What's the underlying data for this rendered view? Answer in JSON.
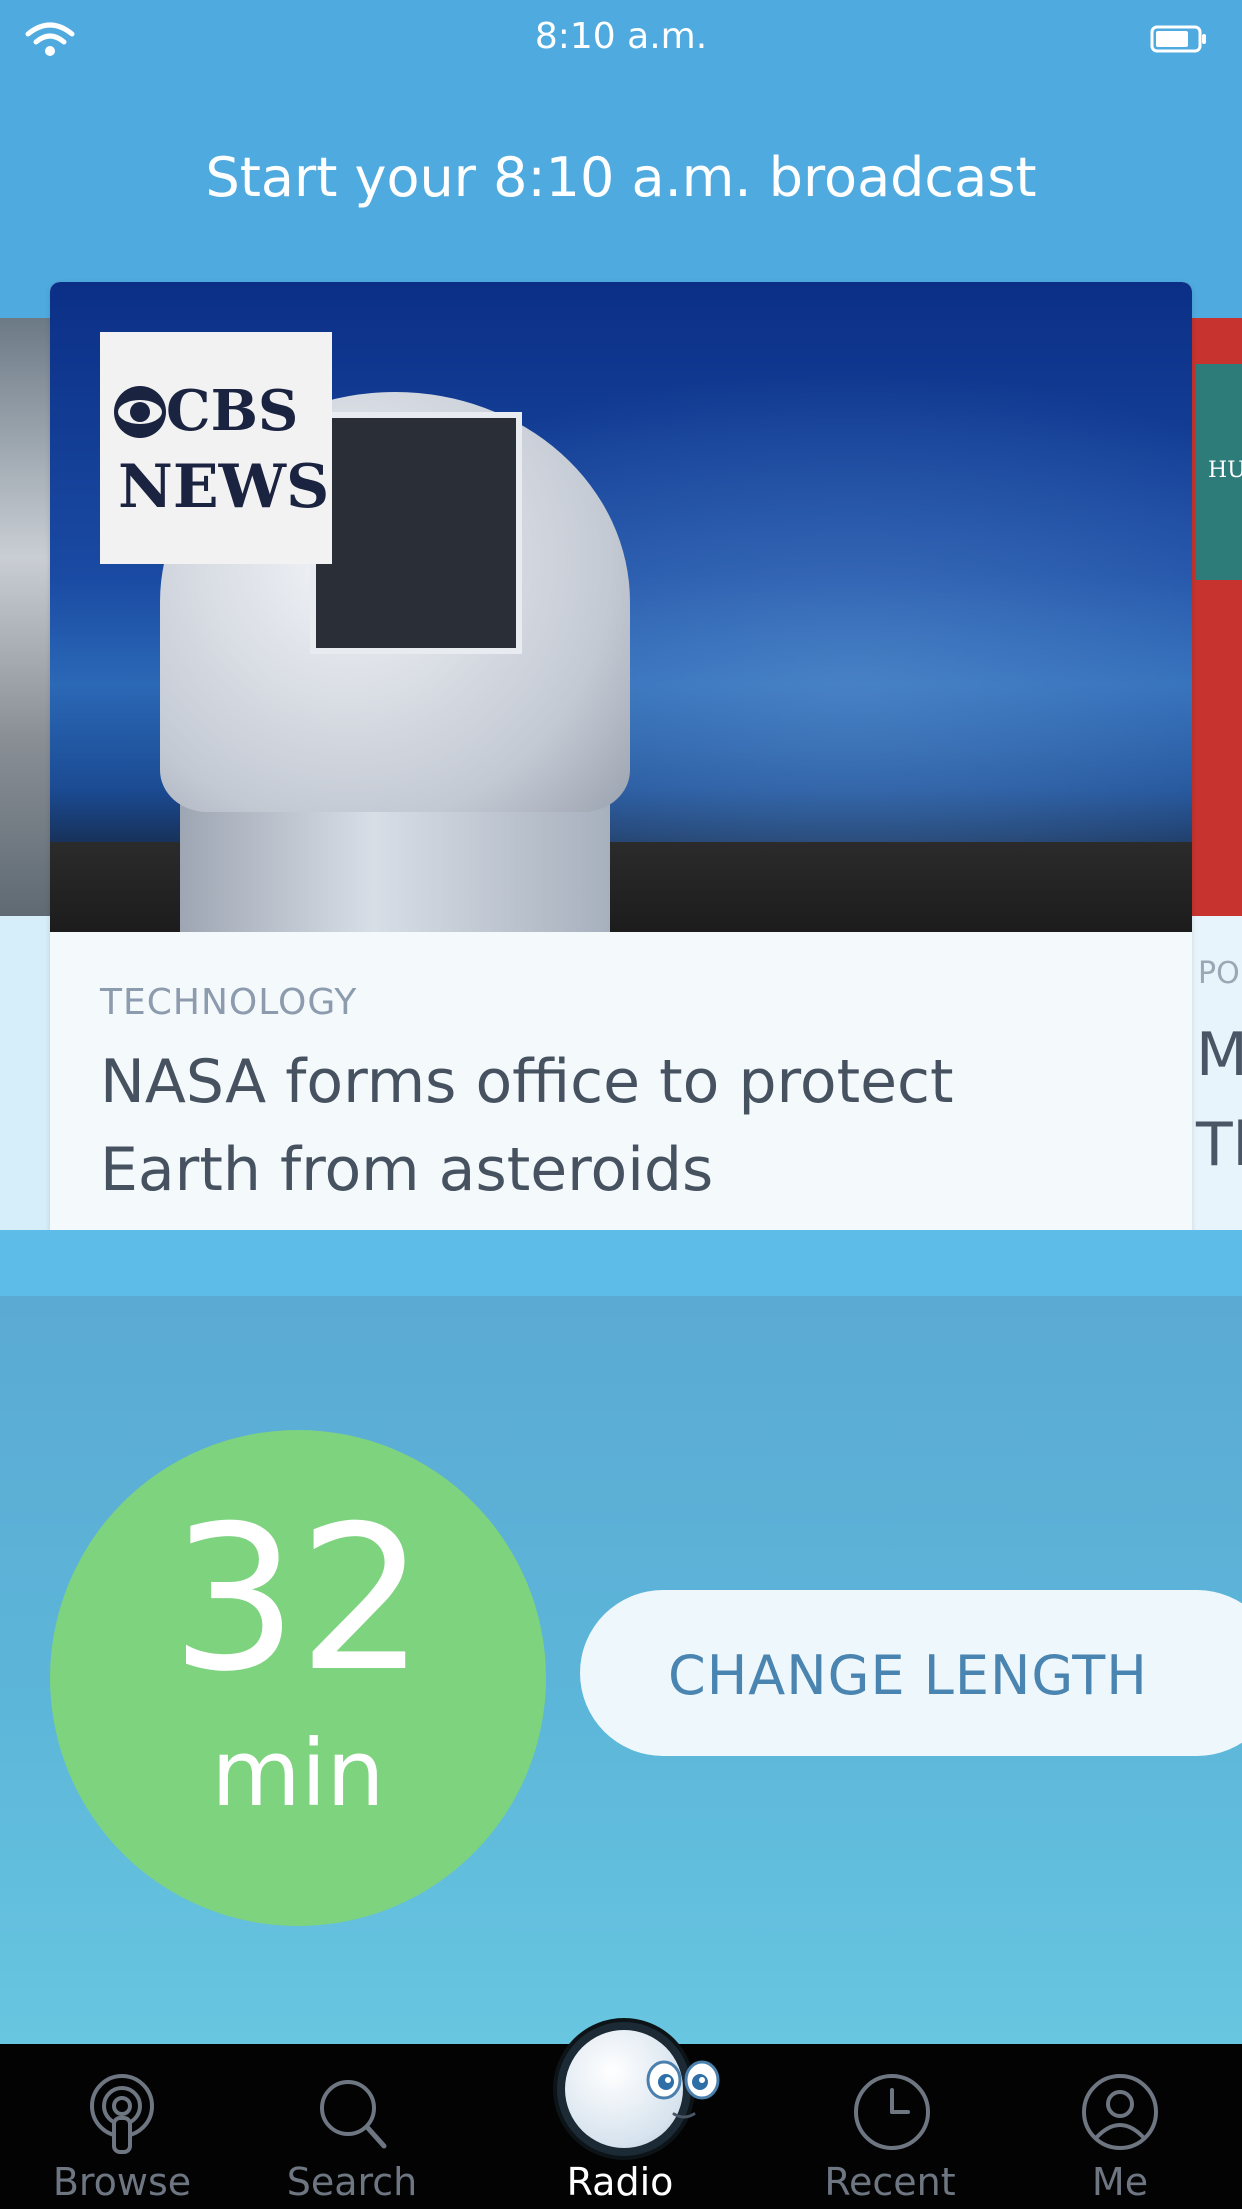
{
  "status_bar": {
    "time": "8:10 a.m.",
    "icons": [
      "wifi-icon",
      "battery-icon"
    ]
  },
  "header": {
    "headline": "Start your 8:10 a.m. broadcast"
  },
  "carousel": {
    "main_card": {
      "source_logo": "CBS NEWS",
      "category": "TECHNOLOGY",
      "title_line1": "NASA forms office to protect",
      "title_line2": "Earth from asteroids"
    },
    "right_card": {
      "category_partial": "PO",
      "title_partial_line1": "M",
      "title_partial_line2": "Tl",
      "panel_text_partial": "HU"
    }
  },
  "broadcast": {
    "length_value": "32",
    "length_unit": "min",
    "change_length_label": "CHANGE LENGTH"
  },
  "tabbar": {
    "tabs": [
      {
        "label": "Browse",
        "icon": "podcast-icon",
        "active": false
      },
      {
        "label": "Search",
        "icon": "search-icon",
        "active": false
      },
      {
        "label": "Radio",
        "icon": "radio-face-icon",
        "active": true
      },
      {
        "label": "Recent",
        "icon": "clock-icon",
        "active": false
      },
      {
        "label": "Me",
        "icon": "person-icon",
        "active": false
      }
    ]
  },
  "colors": {
    "background_blue": "#4FAADF",
    "accent_green": "#7ED37F",
    "button_text": "#4A84B0",
    "tabbar_bg": "#030303"
  }
}
